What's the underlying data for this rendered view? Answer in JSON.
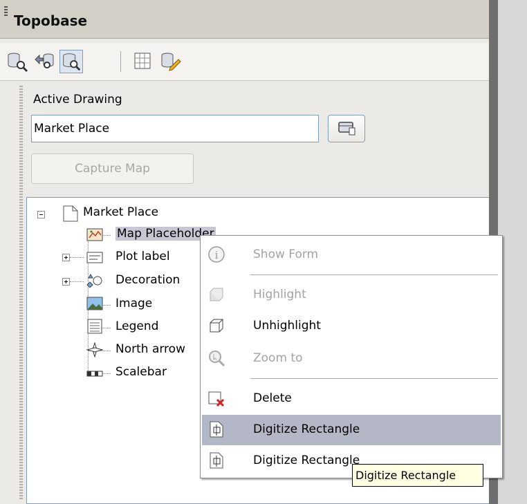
{
  "panel": {
    "title": "Topobase"
  },
  "toolbar": {
    "buttons": [
      {
        "name": "database-find-icon"
      },
      {
        "name": "database-recycle-icon"
      },
      {
        "name": "database-find-active-icon",
        "pressed": true
      },
      {
        "name": "table-grid-icon"
      },
      {
        "name": "database-edit-icon"
      }
    ]
  },
  "drawing": {
    "label": "Active Drawing",
    "value": "Market Place",
    "capture_label": "Capture Map"
  },
  "tree": {
    "root": "Market Place",
    "items": [
      {
        "label": "Map Placeholder",
        "icon": "map-placeholder-icon",
        "selected": true
      },
      {
        "label": "Plot label",
        "icon": "plot-label-icon",
        "expandable": true
      },
      {
        "label": "Decoration",
        "icon": "decoration-icon",
        "expandable": true
      },
      {
        "label": "Image",
        "icon": "image-icon"
      },
      {
        "label": "Legend",
        "icon": "legend-icon"
      },
      {
        "label": "North arrow",
        "icon": "north-arrow-icon"
      },
      {
        "label": "Scalebar",
        "icon": "scalebar-icon"
      }
    ]
  },
  "context_menu": {
    "items": [
      {
        "label": "Show Form",
        "icon": "info-icon",
        "disabled": true
      },
      {
        "label": "Highlight",
        "icon": "highlight-icon",
        "disabled": true
      },
      {
        "label": "Unhighlight",
        "icon": "unhighlight-icon"
      },
      {
        "label": "Zoom to",
        "icon": "zoom-icon",
        "disabled": true
      },
      {
        "label": "Delete",
        "icon": "delete-icon"
      },
      {
        "label": "Digitize Rectangle",
        "icon": "digitize-rectangle-icon",
        "hover": true
      },
      {
        "label": "Digitize Rectangle",
        "icon": "digitize-rectangle-icon"
      }
    ]
  },
  "tooltip": {
    "text": "Digitize Rectangle"
  }
}
